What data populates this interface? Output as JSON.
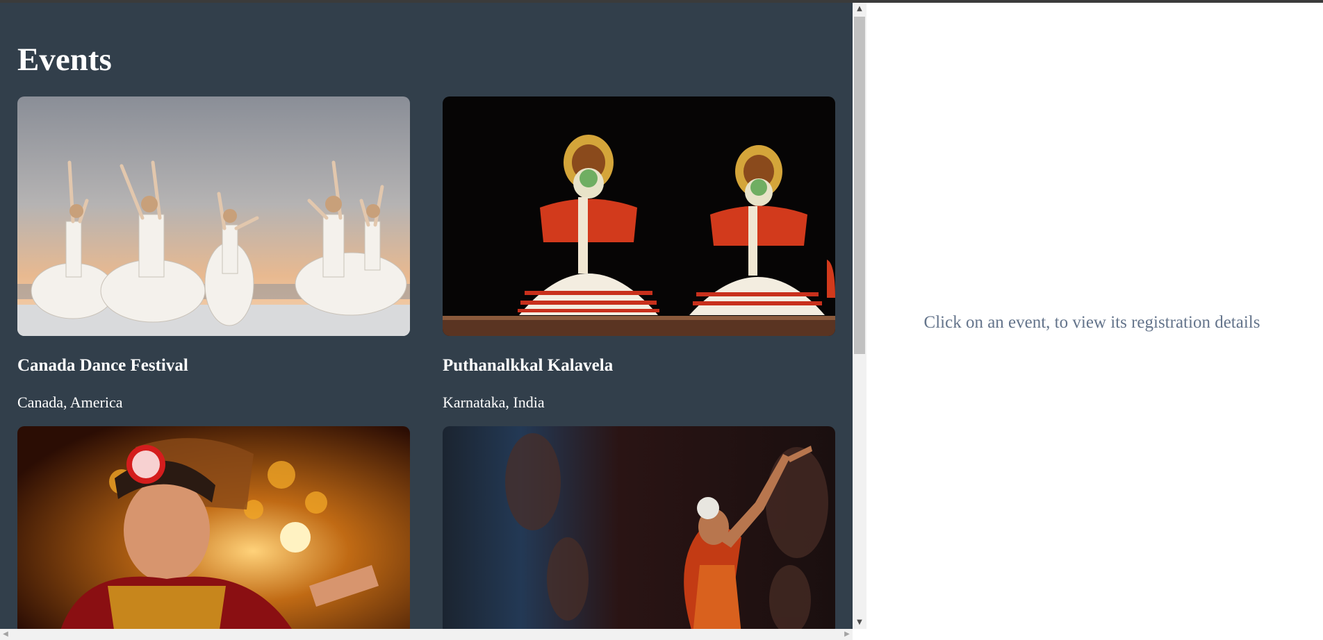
{
  "events": {
    "heading": "Events",
    "cards": [
      {
        "title": "Canada Dance Festival",
        "location": "Canada, America",
        "image_icon": "ballet-dancers-image"
      },
      {
        "title": "Puthanalkkal Kalavela",
        "location": "Karnataka, India",
        "image_icon": "kathakali-dancers-image"
      },
      {
        "title": "",
        "location": "",
        "image_icon": "bharatanatyam-dancer-image"
      },
      {
        "title": "",
        "location": "",
        "image_icon": "classical-dancer-image"
      }
    ]
  },
  "detail": {
    "hint": "Click on an event, to view its registration details"
  },
  "colors": {
    "panel_bg": "#323f4b",
    "hint_text": "#64748b",
    "text": "#ffffff"
  }
}
